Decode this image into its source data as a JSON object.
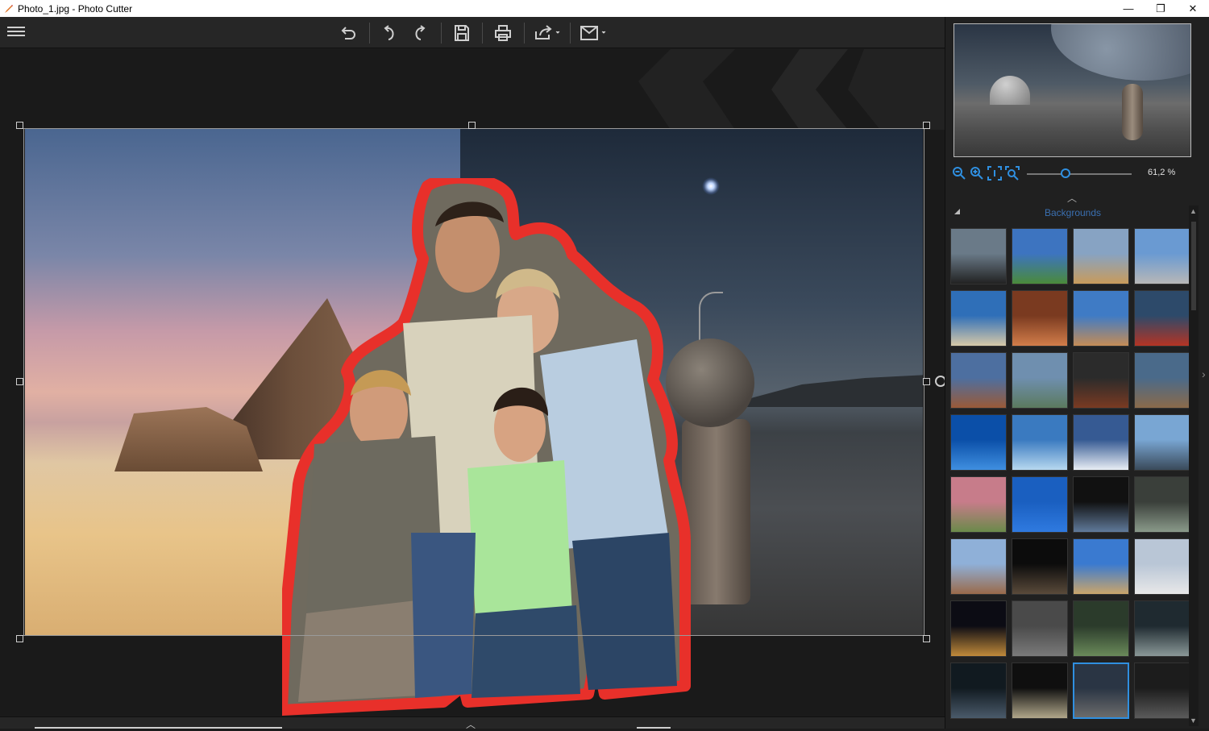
{
  "window": {
    "title": "Photo_1.jpg - Photo Cutter",
    "minimize": "—",
    "restore": "❐",
    "close": "✕"
  },
  "toolbar": {
    "menu_icon": "hamburger-icon",
    "tools": [
      "undo-all-icon",
      "undo-icon",
      "redo-icon",
      "save-icon",
      "print-icon",
      "share-icon",
      "send-icon"
    ]
  },
  "canvas": {
    "selection_handles": 8
  },
  "panel": {
    "zoom_value": "61,2 %",
    "zoom_level_fraction": 0.37,
    "backgrounds_label": "Backgrounds",
    "thumbnails": [
      {
        "name": "bridge",
        "colors": [
          "#6a7a88",
          "#222"
        ]
      },
      {
        "name": "eiffel-tower",
        "colors": [
          "#3d74c0",
          "#4a8a3a"
        ]
      },
      {
        "name": "pyramids",
        "colors": [
          "#87a3c3",
          "#c89b5b"
        ]
      },
      {
        "name": "mount-rushmore",
        "colors": [
          "#6a9ad2",
          "#b7b7b7"
        ]
      },
      {
        "name": "beach-path",
        "colors": [
          "#2f6fb8",
          "#d7c9a8"
        ]
      },
      {
        "name": "waterfall",
        "colors": [
          "#7a3a20",
          "#d27d4a"
        ]
      },
      {
        "name": "desert-road",
        "colors": [
          "#3f7bc5",
          "#c58c56"
        ]
      },
      {
        "name": "red-bicycle",
        "colors": [
          "#2d4a6a",
          "#b43424"
        ]
      },
      {
        "name": "canyon-river",
        "colors": [
          "#4d6fa0",
          "#9a5a38"
        ]
      },
      {
        "name": "island-stadium",
        "colors": [
          "#6f8faf",
          "#5b7a5e"
        ]
      },
      {
        "name": "dark-monument",
        "colors": [
          "#2b2b2b",
          "#7a3a22"
        ]
      },
      {
        "name": "valley-cliffs",
        "colors": [
          "#4a6a8a",
          "#8a6a4a"
        ]
      },
      {
        "name": "blue-sky",
        "colors": [
          "#0b4fa8",
          "#3f8fe0"
        ]
      },
      {
        "name": "ice-lake",
        "colors": [
          "#3a7ac0",
          "#b7d8ef"
        ]
      },
      {
        "name": "snow-mountains",
        "colors": [
          "#365a93",
          "#e8eef5"
        ]
      },
      {
        "name": "venice-gondolas",
        "colors": [
          "#79a6d3",
          "#3a4a5a"
        ]
      },
      {
        "name": "wedding-flowers",
        "colors": [
          "#c77c8a",
          "#6a8a4a"
        ]
      },
      {
        "name": "love-card",
        "colors": [
          "#1a5fc0",
          "#2f7ae0"
        ]
      },
      {
        "name": "space-station-window",
        "colors": [
          "#111",
          "#607a9a"
        ]
      },
      {
        "name": "storm-plane",
        "colors": [
          "#3a3f3a",
          "#8a9a8a"
        ]
      },
      {
        "name": "old-town",
        "colors": [
          "#8fb0d8",
          "#9a6a4a"
        ]
      },
      {
        "name": "dark-cave",
        "colors": [
          "#0c0c0c",
          "#5a4a3a"
        ]
      },
      {
        "name": "dinosaur-beach",
        "colors": [
          "#3a7ad0",
          "#caa56a"
        ]
      },
      {
        "name": "fog-shark",
        "colors": [
          "#b9c6d6",
          "#e8e8e8"
        ]
      },
      {
        "name": "lion-roar",
        "colors": [
          "#0c0c14",
          "#c08a3a"
        ]
      },
      {
        "name": "dinosaur-rocks",
        "colors": [
          "#4a4a4a",
          "#7a7a7a"
        ]
      },
      {
        "name": "pterodactyl-forest",
        "colors": [
          "#2b3b2b",
          "#6a8a5a"
        ]
      },
      {
        "name": "ufo-field",
        "colors": [
          "#1f2a30",
          "#8a9898"
        ]
      },
      {
        "name": "dark-forest",
        "colors": [
          "#111a20",
          "#4a5a6a"
        ]
      },
      {
        "name": "tunnel-bridge",
        "colors": [
          "#0f0f0f",
          "#b0a68a"
        ]
      },
      {
        "name": "moon-base",
        "colors": [
          "#2a3544",
          "#6b6b6b"
        ],
        "selected": true
      },
      {
        "name": "moon-surface",
        "colors": [
          "#1c1c1c",
          "#5a5a5a"
        ]
      }
    ]
  },
  "colors": {
    "accent": "#2f8fe0",
    "cutout_outline": "#e8302a",
    "panel_bg": "#202020",
    "toolbar_bg": "#262626"
  }
}
